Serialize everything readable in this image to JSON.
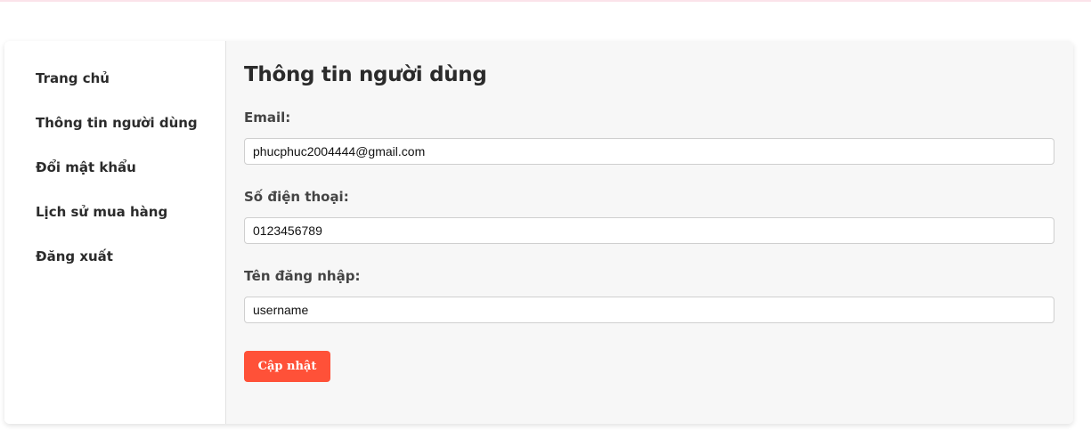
{
  "sidebar": {
    "items": [
      {
        "label": "Trang chủ"
      },
      {
        "label": "Thông tin người dùng"
      },
      {
        "label": "Đổi mật khẩu"
      },
      {
        "label": "Lịch sử mua hàng"
      },
      {
        "label": "Đăng xuất"
      }
    ]
  },
  "main": {
    "title": "Thông tin người dùng",
    "fields": {
      "email": {
        "label": "Email:",
        "value": "phucphuc2004444@gmail.com"
      },
      "phone": {
        "label": "Số điện thoại:",
        "value": "0123456789"
      },
      "username": {
        "label": "Tên đăng nhập:",
        "value": "username"
      }
    },
    "update_label": "Cập nhật"
  },
  "colors": {
    "accent": "#ff5138",
    "main_background": "#f7f7f7",
    "text": "#2b2b2b"
  }
}
